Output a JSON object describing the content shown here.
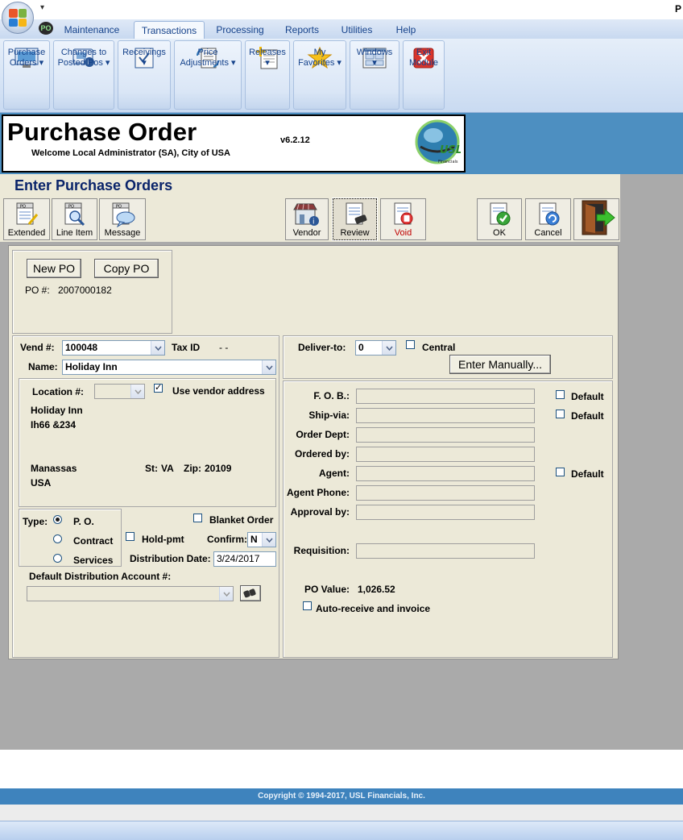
{
  "app": {
    "corner_letter": "P",
    "quick_access_arrow": "▾",
    "po_badge": "PO"
  },
  "ribbon_tabs": [
    {
      "label": "Maintenance"
    },
    {
      "label": "Transactions"
    },
    {
      "label": "Processing"
    },
    {
      "label": "Reports"
    },
    {
      "label": "Utilities"
    },
    {
      "label": "Help"
    }
  ],
  "ribbon_groups": [
    {
      "line1": "Purchase",
      "line2": "Orders ▾",
      "icon": "purchase-orders-icon"
    },
    {
      "line1": "Changes to",
      "line2": "Posted Pos ▾",
      "icon": "changes-posted-icon"
    },
    {
      "line1": "Receivings",
      "line2": "▾",
      "icon": "receivings-icon"
    },
    {
      "line1": "Price",
      "line2": "Adjustments ▾",
      "icon": "price-adjustments-icon"
    },
    {
      "line1": "Releases",
      "line2": "▾",
      "icon": "releases-icon"
    },
    {
      "line1": "My",
      "line2": "Favorites ▾",
      "icon": "star-icon"
    },
    {
      "line1": "Windows",
      "line2": "▾",
      "icon": "windows-icon"
    },
    {
      "line1": "Exit",
      "line2": "Module",
      "icon": "exit-icon"
    }
  ],
  "header": {
    "title": "Purchase Order",
    "welcome": "Welcome Local Administrator (SA), City of USA",
    "version": "v6.2.12",
    "logo_text": "USL",
    "logo_sub": "Financials"
  },
  "page": {
    "subtitle": "Enter Purchase Orders"
  },
  "toolbar": {
    "extended": "Extended",
    "line_item": "Line Item",
    "message": "Message",
    "po_tag": "PO",
    "vendor": "Vendor",
    "review": "Review",
    "void": "Void",
    "ok": "OK",
    "cancel": "Cancel"
  },
  "po": {
    "new_po": "New PO",
    "copy_po": "Copy PO",
    "po_num_label": "PO #:",
    "po_num": "2007000182"
  },
  "vendor": {
    "vend_label": "Vend #:",
    "vend_value": "100048",
    "tax_label": "Tax ID",
    "tax_value": "- -",
    "name_label": "Name:",
    "name_value": "Holiday Inn",
    "location_label": "Location #:",
    "location_value": "",
    "use_vendor_address": "Use vendor address",
    "use_vendor_checked": "✓",
    "addr_line1": "Holiday Inn",
    "addr_line2": "Ih66 &234",
    "city": "Manassas",
    "state_label": "St:",
    "state": "VA",
    "zip_label": "Zip:",
    "zip": "20109",
    "country": "USA"
  },
  "type": {
    "label": "Type:",
    "po": "P. O.",
    "contract": "Contract",
    "services": "Services",
    "selected": "P. O."
  },
  "options": {
    "blanket_order": "Blanket Order",
    "hold_pmt": "Hold-pmt",
    "confirm_label": "Confirm:",
    "confirm_value": "N",
    "dist_date_label": "Distribution Date:",
    "dist_date_value": "3/24/2017",
    "default_dist_label": "Default Distribution Account #:",
    "default_dist_value": ""
  },
  "delivery": {
    "deliver_to_label": "Deliver-to:",
    "deliver_to_value": "0",
    "central": "Central",
    "enter_manually": "Enter Manually..."
  },
  "details": {
    "fob_label": "F. O. B.:",
    "ship_via_label": "Ship-via:",
    "order_dept_label": "Order Dept:",
    "ordered_by_label": "Ordered by:",
    "agent_label": "Agent:",
    "agent_phone_label": "Agent Phone:",
    "approval_label": "Approval by:",
    "requisition_label": "Requisition:",
    "default": "Default",
    "po_value_label": "PO Value:",
    "po_value": "1,026.52",
    "auto_receive": "Auto-receive and invoice"
  },
  "footer": {
    "copyright": "Copyright © 1994-2017, USL Financials, Inc."
  },
  "colors": {
    "header_band": "#4d8fc1",
    "subtitle": "#0a246a",
    "form_bg": "#ece9d8",
    "copyright_bar": "#3e83bd",
    "void_red": "#c00000"
  }
}
